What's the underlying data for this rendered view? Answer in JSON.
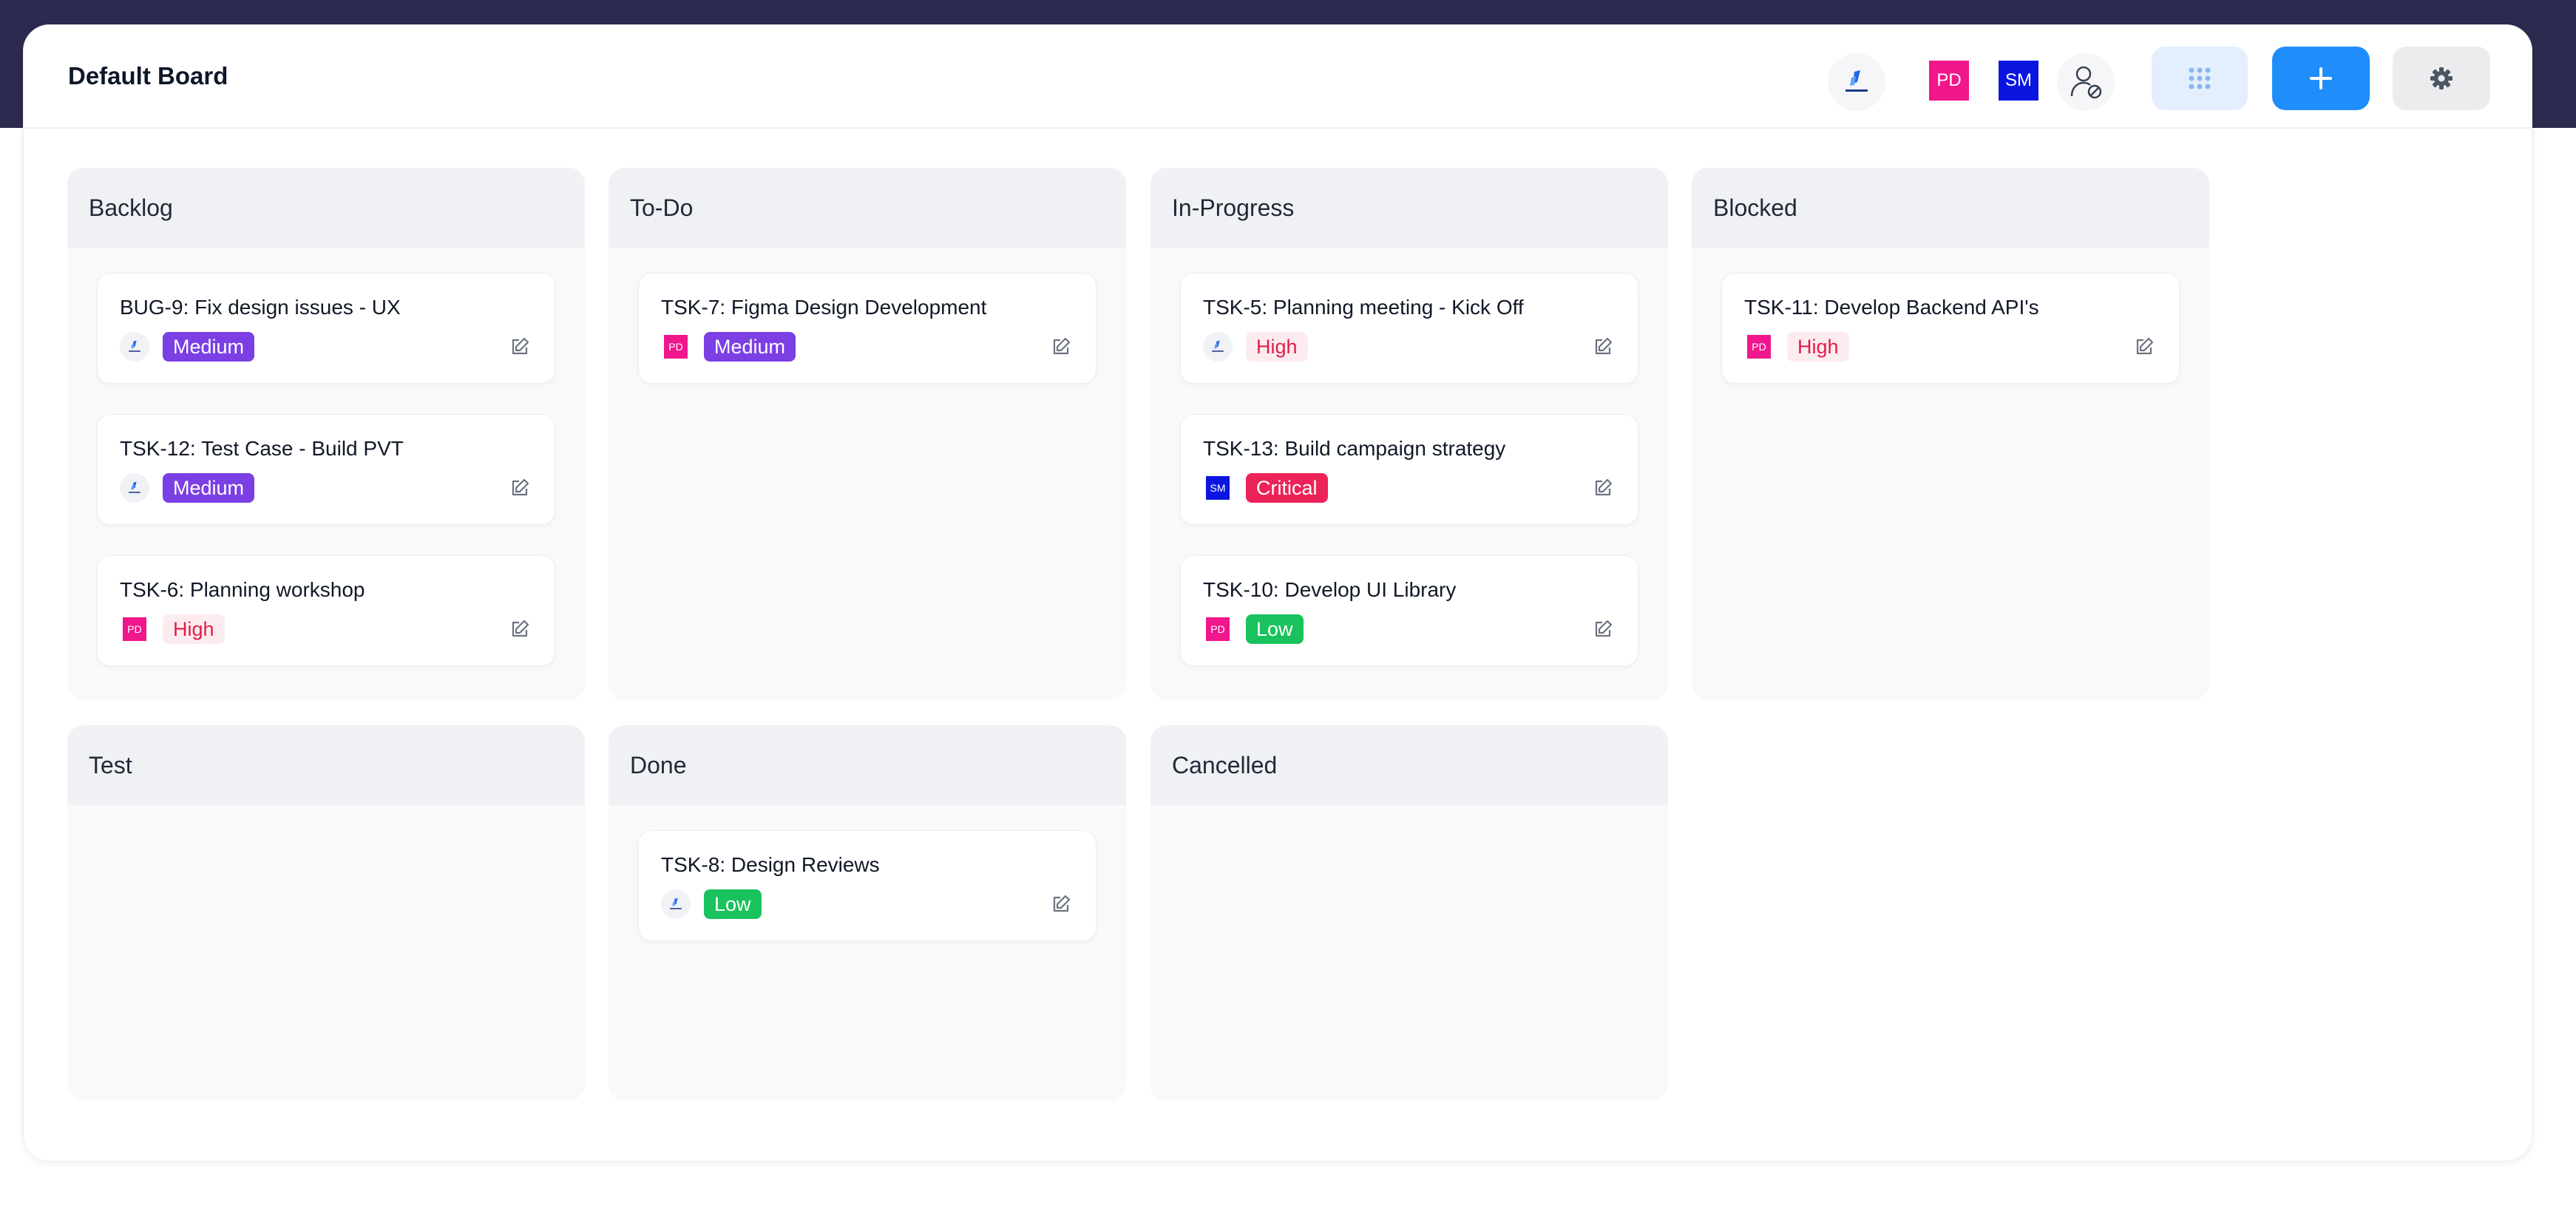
{
  "board": {
    "title": "Default Board"
  },
  "header": {
    "members": [
      {
        "kind": "logo",
        "name": "company-logo"
      },
      {
        "kind": "initials",
        "initials": "PD",
        "color": "#f0168c"
      },
      {
        "kind": "initials",
        "initials": "SM",
        "color": "#0a16e0"
      },
      {
        "kind": "icon",
        "name": "user-blocked-icon"
      }
    ],
    "buttons": {
      "grid_icon": "grid-dots-icon",
      "add_icon": "plus-icon",
      "settings_icon": "gear-icon"
    }
  },
  "colors": {
    "primary": "#1f8efa",
    "header_band": "#2c2a4e",
    "medium": "#7b3fe4",
    "high_text": "#e11d48",
    "high_bg": "#fdecef",
    "critical": "#ec2358",
    "low": "#19c25c"
  },
  "lanes": [
    {
      "title": "Backlog",
      "cards": [
        {
          "title": "BUG-9: Fix design issues - UX",
          "assignee": "logo",
          "priority": "Medium"
        },
        {
          "title": "TSK-12: Test Case - Build PVT",
          "assignee": "logo",
          "priority": "Medium"
        },
        {
          "title": "TSK-6: Planning workshop",
          "assignee": "PD",
          "priority": "High"
        }
      ]
    },
    {
      "title": "To-Do",
      "cards": [
        {
          "title": "TSK-7: Figma Design Development",
          "assignee": "PD",
          "priority": "Medium"
        }
      ]
    },
    {
      "title": "In-Progress",
      "cards": [
        {
          "title": "TSK-5: Planning meeting - Kick Off",
          "assignee": "logo",
          "priority": "High"
        },
        {
          "title": "TSK-13: Build campaign strategy",
          "assignee": "SM",
          "priority": "Critical"
        },
        {
          "title": "TSK-10: Develop UI Library",
          "assignee": "PD",
          "priority": "Low"
        }
      ]
    },
    {
      "title": "Blocked",
      "cards": [
        {
          "title": "TSK-11: Develop Backend API's",
          "assignee": "PD",
          "priority": "High"
        }
      ]
    },
    {
      "title": "Test",
      "cards": []
    },
    {
      "title": "Done",
      "cards": [
        {
          "title": "TSK-8: Design Reviews",
          "assignee": "logo",
          "priority": "Low"
        }
      ]
    },
    {
      "title": "Cancelled",
      "cards": []
    }
  ]
}
